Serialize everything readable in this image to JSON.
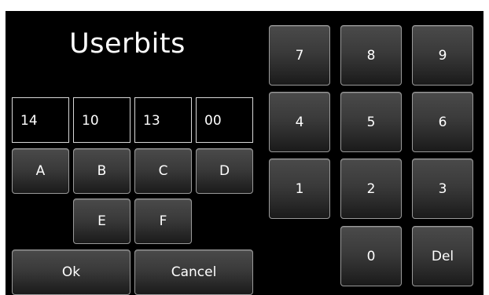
{
  "title": "Userbits",
  "fields": [
    "14",
    "10",
    "13",
    "00"
  ],
  "hex_keys": [
    "A",
    "B",
    "C",
    "D",
    "E",
    "F"
  ],
  "actions": {
    "ok": "Ok",
    "cancel": "Cancel"
  },
  "numpad": [
    "7",
    "8",
    "9",
    "4",
    "5",
    "6",
    "1",
    "2",
    "3",
    "0",
    "Del"
  ]
}
